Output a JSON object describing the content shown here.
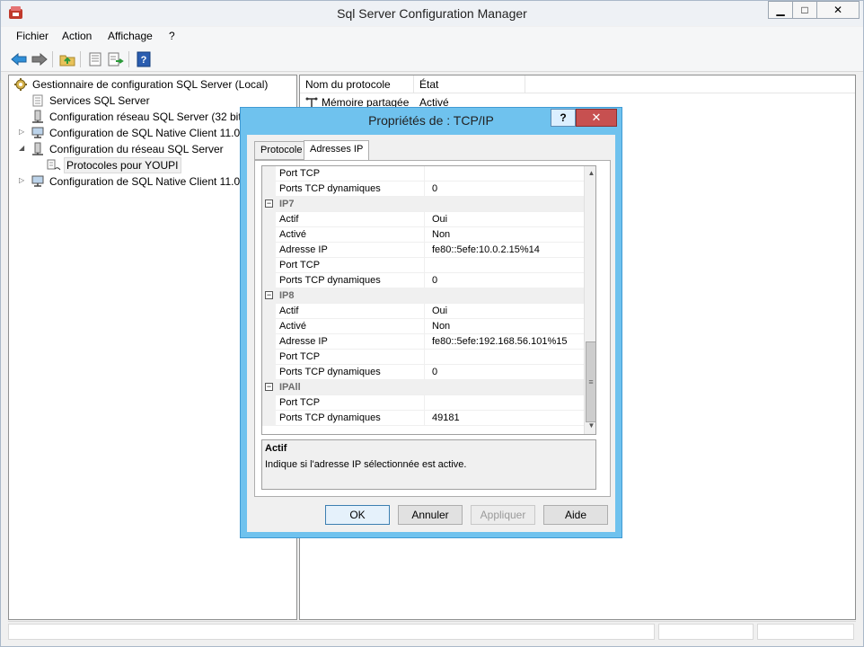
{
  "window": {
    "title": "Sql Server Configuration Manager",
    "min_glyph": "▁",
    "max_glyph": "□",
    "close_glyph": "✕"
  },
  "menu": [
    "Fichier",
    "Action",
    "Affichage",
    "?"
  ],
  "tree": {
    "root": "Gestionnaire de configuration SQL Server (Local)",
    "items": [
      "Services SQL Server",
      "Configuration réseau SQL Server (32 bits)",
      "Configuration de SQL Native Client 11.0 (",
      "Configuration du réseau SQL Server",
      "Protocoles pour YOUPI",
      "Configuration de SQL Native Client 11.0"
    ]
  },
  "list": {
    "columns": [
      "Nom du protocole",
      "État"
    ],
    "rows": [
      {
        "name": "Mémoire partagée",
        "state": "Activé"
      }
    ]
  },
  "dialog": {
    "title": "Propriétés de : TCP/IP",
    "help_glyph": "?",
    "close_glyph": "✕",
    "tabs": [
      "Protocole",
      "Adresses IP"
    ],
    "rows": [
      {
        "kind": "prop",
        "name": "Port TCP",
        "value": ""
      },
      {
        "kind": "prop",
        "name": "Ports TCP dynamiques",
        "value": "0"
      },
      {
        "kind": "cat",
        "name": "IP7"
      },
      {
        "kind": "prop",
        "name": "Actif",
        "value": "Oui"
      },
      {
        "kind": "prop",
        "name": "Activé",
        "value": "Non"
      },
      {
        "kind": "prop",
        "name": "Adresse IP",
        "value": "fe80::5efe:10.0.2.15%14"
      },
      {
        "kind": "prop",
        "name": "Port TCP",
        "value": ""
      },
      {
        "kind": "prop",
        "name": "Ports TCP dynamiques",
        "value": "0"
      },
      {
        "kind": "cat",
        "name": "IP8"
      },
      {
        "kind": "prop",
        "name": "Actif",
        "value": "Oui"
      },
      {
        "kind": "prop",
        "name": "Activé",
        "value": "Non"
      },
      {
        "kind": "prop",
        "name": "Adresse IP",
        "value": "fe80::5efe:192.168.56.101%15"
      },
      {
        "kind": "prop",
        "name": "Port TCP",
        "value": ""
      },
      {
        "kind": "prop",
        "name": "Ports TCP dynamiques",
        "value": "0"
      },
      {
        "kind": "cat",
        "name": "IPAll"
      },
      {
        "kind": "prop",
        "name": "Port TCP",
        "value": ""
      },
      {
        "kind": "prop",
        "name": "Ports TCP dynamiques",
        "value": "49181"
      }
    ],
    "description": {
      "title": "Actif",
      "text": "Indique si l'adresse IP sélectionnée est active."
    },
    "buttons": {
      "ok": "OK",
      "cancel": "Annuler",
      "apply": "Appliquer",
      "help": "Aide"
    },
    "expander_glyph": "−",
    "scroll_up_glyph": "▲",
    "scroll_down_glyph": "▼",
    "scroll_grip_glyph": "≡"
  },
  "colors": {
    "dialog_frame": "#6fc2ee",
    "close_button": "#c75050",
    "default_button_border": "#3c7fb1"
  }
}
